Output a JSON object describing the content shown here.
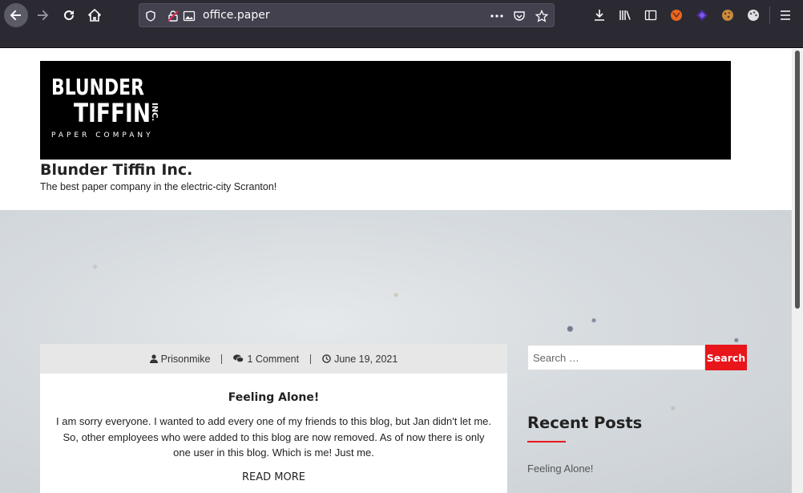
{
  "browser": {
    "url": "office.paper"
  },
  "site": {
    "logo_line1": "BLUNDER",
    "logo_line2": "TIFFIN",
    "logo_inc": "INC.",
    "logo_sub": "PAPER COMPANY",
    "title": "Blunder Tiffin Inc.",
    "tagline": "The best paper company in the electric-city Scranton!"
  },
  "post": {
    "author": "Prisonmike",
    "comments": "1 Comment",
    "date": "June 19, 2021",
    "title": "Feeling Alone!",
    "body": "I am sorry everyone. I wanted to add every one of my friends to this blog, but Jan didn't let me. So, other employees who were added to this blog are now removed. As of now there is only one user in this blog. Which is me! Just me.",
    "read_more": "READ MORE"
  },
  "sidebar": {
    "search_placeholder": "Search …",
    "search_button": "Search",
    "recent_title": "Recent Posts",
    "recent_items": [
      "Feeling Alone!"
    ]
  },
  "colors": {
    "accent": "#e8151b",
    "toolbar": "#2b2a33"
  }
}
